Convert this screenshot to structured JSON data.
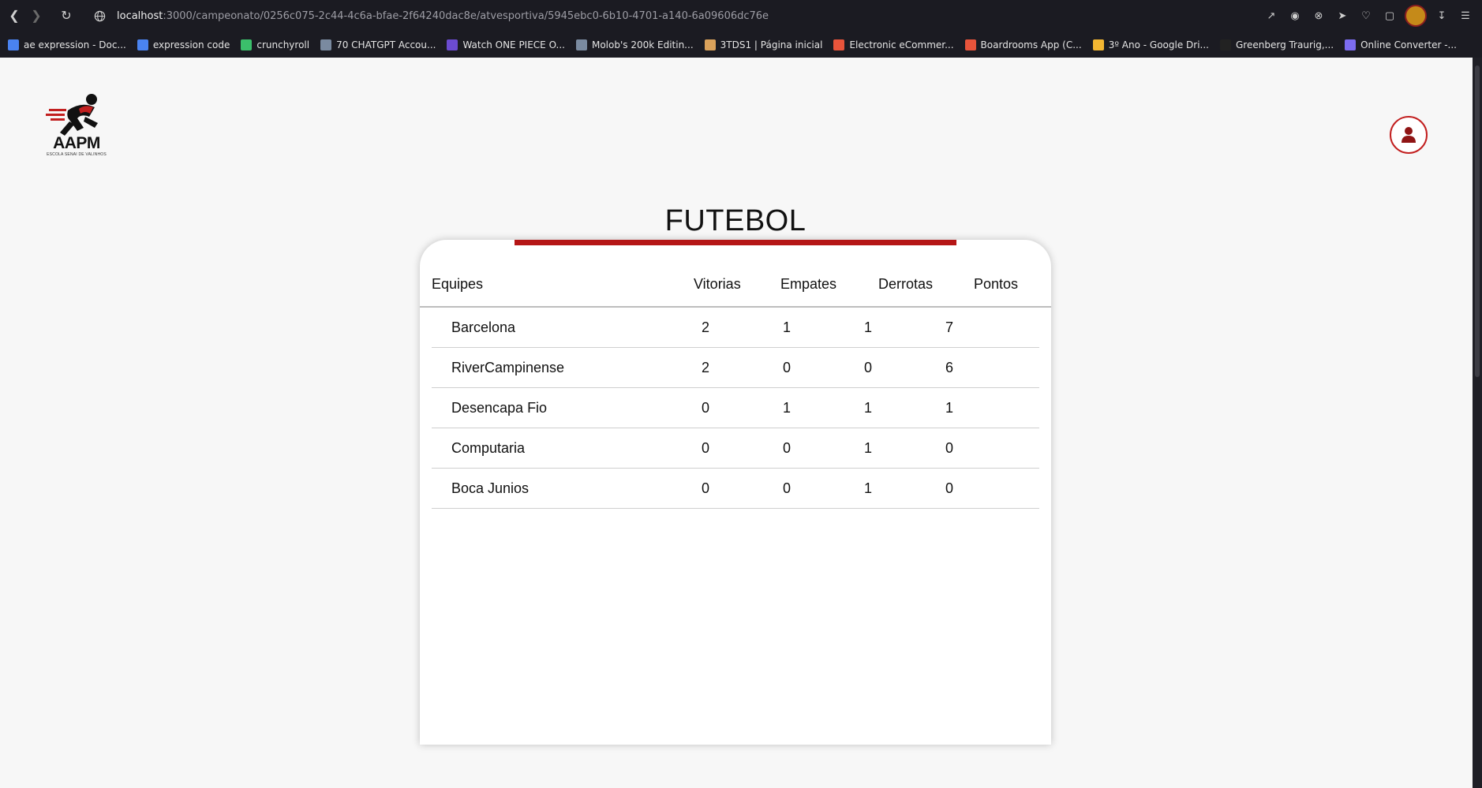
{
  "browser": {
    "url_host": "localhost",
    "url_path": ":3000/campeonato/0256c075-2c44-4c6a-bfae-2f64240dac8e/atvesportiva/5945ebc0-6b10-4701-a140-6a09606dc76e",
    "bookmarks": [
      {
        "label": "ae expression - Doc...",
        "color": "#4a83f0"
      },
      {
        "label": "expression code",
        "color": "#4a83f0"
      },
      {
        "label": "crunchyroll",
        "color": "#3bbf6b"
      },
      {
        "label": "70 CHATGPT Accou...",
        "color": "#7a8aa0"
      },
      {
        "label": "Watch ONE PIECE O...",
        "color": "#6b4bd1"
      },
      {
        "label": "Molob's 200k Editin...",
        "color": "#7a8aa0"
      },
      {
        "label": "3TDS1 | Página inicial",
        "color": "#d9a15a"
      },
      {
        "label": "Electronic eCommer...",
        "color": "#e8543b"
      },
      {
        "label": "Boardrooms App (C...",
        "color": "#e8543b"
      },
      {
        "label": "3º Ano - Google Dri...",
        "color": "#f2b632"
      },
      {
        "label": "Greenberg Traurig,...",
        "color": "#222222"
      },
      {
        "label": "Online Converter -...",
        "color": "#7c6cf0"
      }
    ]
  },
  "header": {
    "logo_text": "AAPM",
    "logo_subtext": "ESCOLA SENAI DE VALINHOS"
  },
  "page": {
    "title": "FUTEBOL"
  },
  "table": {
    "columns": [
      "Equipes",
      "Vitorias",
      "Empates",
      "Derrotas",
      "Pontos"
    ],
    "rows": [
      {
        "team": "Barcelona",
        "vitorias": "2",
        "empates": "1",
        "derrotas": "1",
        "pontos": "7"
      },
      {
        "team": "RiverCampinense",
        "vitorias": "2",
        "empates": "0",
        "derrotas": "0",
        "pontos": "6"
      },
      {
        "team": "Desencapa Fio",
        "vitorias": "0",
        "empates": "1",
        "derrotas": "1",
        "pontos": "1"
      },
      {
        "team": "Computaria",
        "vitorias": "0",
        "empates": "0",
        "derrotas": "1",
        "pontos": "0"
      },
      {
        "team": "Boca Junios",
        "vitorias": "0",
        "empates": "0",
        "derrotas": "1",
        "pontos": "0"
      }
    ]
  },
  "colors": {
    "accent": "#b51616",
    "background": "#f7f7f7"
  }
}
